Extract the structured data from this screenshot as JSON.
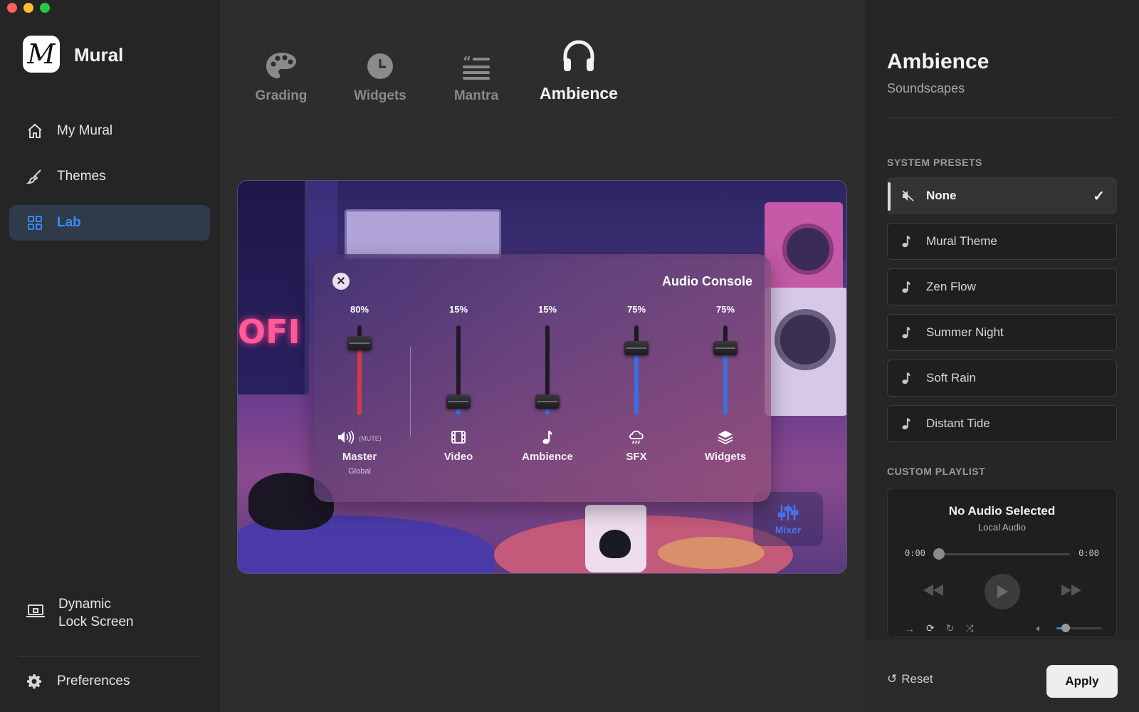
{
  "window": {
    "traffic_colors": [
      "#ff5f57",
      "#febc2e",
      "#28c840"
    ]
  },
  "sidebar": {
    "logo_letter": "M",
    "app_name": "Mural",
    "items": [
      {
        "label": "My Mural",
        "icon": "house-icon"
      },
      {
        "label": "Themes",
        "icon": "paintbrush-icon"
      },
      {
        "label": "Lab",
        "icon": "grid-icon",
        "active": true
      }
    ],
    "lock_screen_line1": "Dynamic",
    "lock_screen_line2": "Lock Screen",
    "preferences": "Preferences"
  },
  "tabs": [
    {
      "label": "Grading",
      "icon": "palette-icon"
    },
    {
      "label": "Widgets",
      "icon": "clock-icon"
    },
    {
      "label": "Mantra",
      "icon": "quote-icon"
    },
    {
      "label": "Ambience",
      "icon": "headphones-icon",
      "active": true
    }
  ],
  "preview": {
    "sign_text": "OFI",
    "mixer_label": "Mixer"
  },
  "console": {
    "title": "Audio Console",
    "mute_label": "(MUTE)",
    "channels": [
      {
        "name": "Master",
        "sub": "Global",
        "percent": "80%",
        "value": 0.8,
        "icon": "speaker-icon",
        "color": "#d23a4a"
      },
      {
        "name": "Video",
        "percent": "15%",
        "value": 0.15,
        "icon": "film-icon",
        "color": "#3b6fe0"
      },
      {
        "name": "Ambience",
        "percent": "15%",
        "value": 0.15,
        "icon": "music-note-icon",
        "color": "#3b6fe0"
      },
      {
        "name": "SFX",
        "percent": "75%",
        "value": 0.75,
        "icon": "rain-cloud-icon",
        "color": "#3b6fe0"
      },
      {
        "name": "Widgets",
        "percent": "75%",
        "value": 0.75,
        "icon": "layers-icon",
        "color": "#3b6fe0"
      }
    ]
  },
  "panel": {
    "title": "Ambience",
    "subtitle": "Soundscapes",
    "system_presets_title": "SYSTEM PRESETS",
    "presets": [
      {
        "label": "None",
        "icon": "mute-icon",
        "selected": true
      },
      {
        "label": "Mural Theme",
        "icon": "music-note-icon"
      },
      {
        "label": "Zen Flow",
        "icon": "music-note-icon"
      },
      {
        "label": "Summer Night",
        "icon": "music-note-icon"
      },
      {
        "label": "Soft Rain",
        "icon": "music-note-icon"
      },
      {
        "label": "Distant Tide",
        "icon": "music-note-icon"
      }
    ],
    "custom_playlist_title": "CUSTOM PLAYLIST",
    "player": {
      "title": "No Audio Selected",
      "subtitle": "Local Audio",
      "elapsed": "0:00",
      "duration": "0:00",
      "progress": 0,
      "volume": 0.2
    },
    "reset_label": "Reset",
    "apply_label": "Apply"
  }
}
